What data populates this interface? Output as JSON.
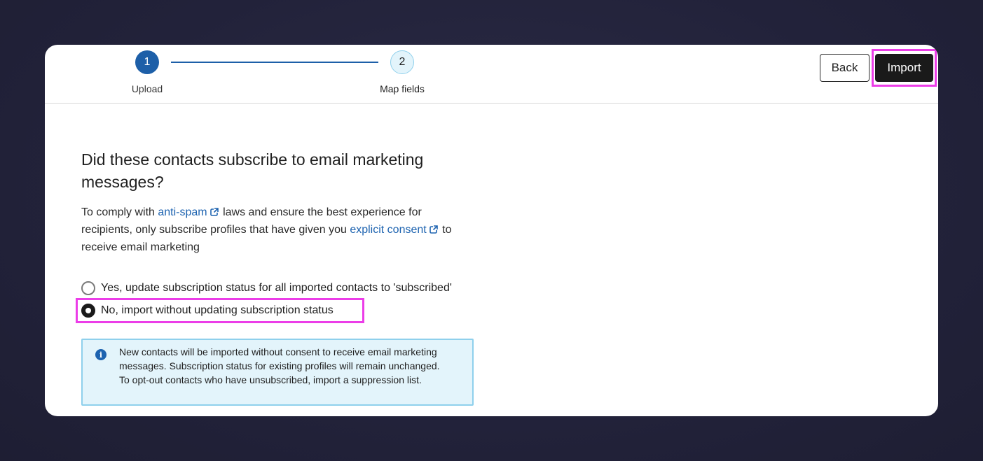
{
  "stepper": {
    "steps": [
      {
        "number": "1",
        "label": "Upload",
        "state": "complete"
      },
      {
        "number": "2",
        "label": "Map fields",
        "state": "current"
      }
    ]
  },
  "header": {
    "back_label": "Back",
    "import_label": "Import"
  },
  "consent": {
    "heading": "Did these contacts subscribe to email marketing messages?",
    "desc_part1": "To comply with ",
    "link_antispam": "anti-spam",
    "desc_part2": " laws and ensure the best experience for recipients, only subscribe profiles that have given you ",
    "link_consent": "explicit consent",
    "desc_part3": " to receive email marketing",
    "options": [
      {
        "label": "Yes, update subscription status for all imported contacts to 'subscribed'",
        "selected": false
      },
      {
        "label": "No, import without updating subscription status",
        "selected": true
      }
    ],
    "info_text": "New contacts will be imported without consent to receive email marketing messages. Subscription status for existing profiles will remain unchanged. To opt-out contacts who have unsubscribed, import a suppression list."
  },
  "colors": {
    "accent": "#1d5fa8",
    "link": "#1d63b0",
    "highlight": "#ec3de8",
    "info_bg": "#e3f4fb",
    "info_border": "#8fd0ec",
    "primary_button": "#1a1a1a"
  },
  "icons": {
    "external_link": "external-link-icon",
    "info": "info-icon"
  }
}
